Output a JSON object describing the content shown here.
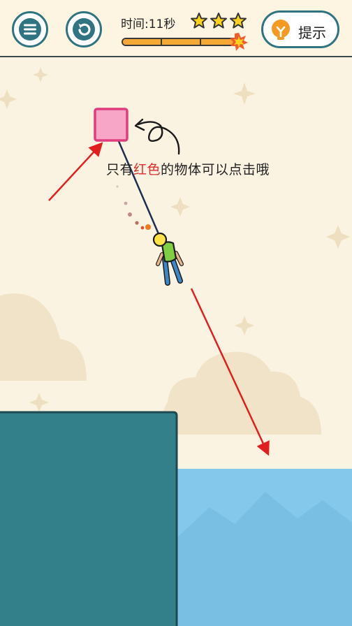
{
  "header": {
    "time_label": "时间:11秒",
    "stars_earned": 3,
    "stars_total": 3,
    "progress": 0.97,
    "hint_label": "提示"
  },
  "icons": {
    "menu": "menu-icon",
    "restart": "restart-icon",
    "hint": "lightbulb-icon",
    "star": "star-icon"
  },
  "instruction": {
    "part1": "只有",
    "highlight": "红色",
    "part2": "的物体可以点击哦"
  },
  "colors": {
    "accent": "#2f7480",
    "clickable_block": "#f7a6c8",
    "water": "#84c9ec",
    "platform": "#337f8a",
    "arrow": "#e21f1f",
    "star": "#ffd21f"
  }
}
